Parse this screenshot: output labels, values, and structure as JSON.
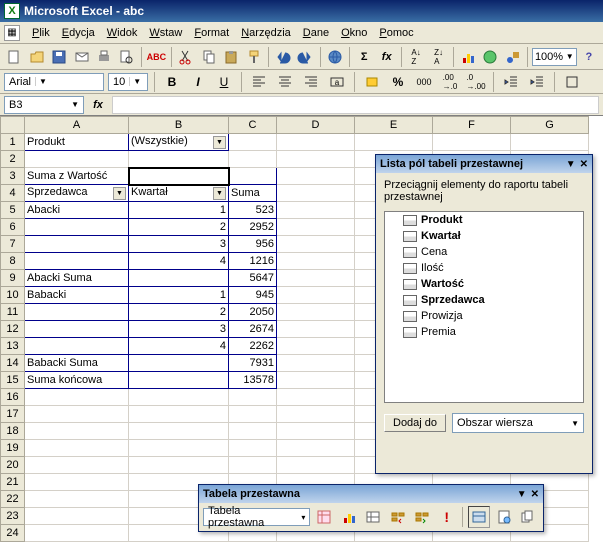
{
  "title": "Microsoft Excel - abc",
  "menus": [
    "Plik",
    "Edycja",
    "Widok",
    "Wstaw",
    "Format",
    "Narzędzia",
    "Dane",
    "Okno",
    "Pomoc"
  ],
  "zoom": "100%",
  "font": {
    "name": "Arial",
    "size": "10"
  },
  "namebox": "B3",
  "columns": [
    "A",
    "B",
    "C",
    "D",
    "E",
    "F",
    "G"
  ],
  "rowcount": 24,
  "pivot": {
    "pageFieldLabel": "Produkt",
    "pageFieldValue": "(Wszystkie)",
    "dataFieldLabel": "Suma z Wartość",
    "rowFieldLabel": "Sprzedawca",
    "colFieldLabel": "Kwartał",
    "sumLabel": "Suma",
    "rows": [
      {
        "a": "Abacki",
        "b": "1",
        "c": "523"
      },
      {
        "a": "",
        "b": "2",
        "c": "2952"
      },
      {
        "a": "",
        "b": "3",
        "c": "956"
      },
      {
        "a": "",
        "b": "4",
        "c": "1216"
      },
      {
        "a": "Abacki Suma",
        "b": "",
        "c": "5647"
      },
      {
        "a": "Babacki",
        "b": "1",
        "c": "945"
      },
      {
        "a": "",
        "b": "2",
        "c": "2050"
      },
      {
        "a": "",
        "b": "3",
        "c": "2674"
      },
      {
        "a": "",
        "b": "4",
        "c": "2262"
      },
      {
        "a": "Babacki Suma",
        "b": "",
        "c": "7931"
      },
      {
        "a": "Suma końcowa",
        "b": "",
        "c": "13578"
      }
    ]
  },
  "fieldList": {
    "title": "Lista pól tabeli przestawnej",
    "desc": "Przeciągnij elementy do raportu tabeli przestawnej",
    "fields": [
      {
        "name": "Produkt",
        "used": true
      },
      {
        "name": "Kwartał",
        "used": true
      },
      {
        "name": "Cena",
        "used": false
      },
      {
        "name": "Ilość",
        "used": false
      },
      {
        "name": "Wartość",
        "used": true
      },
      {
        "name": "Sprzedawca",
        "used": true
      },
      {
        "name": "Prowizja",
        "used": false
      },
      {
        "name": "Premia",
        "used": false
      }
    ],
    "addBtn": "Dodaj do",
    "areaDrop": "Obszar wiersza"
  },
  "pvToolbar": {
    "title": "Tabela przestawna",
    "menuLabel": "Tabela przestawna"
  }
}
